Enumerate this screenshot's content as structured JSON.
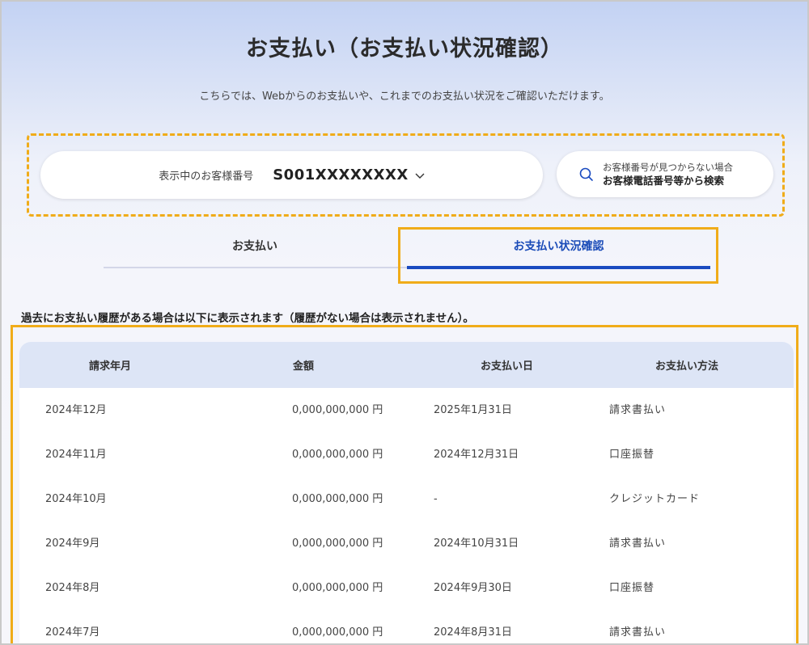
{
  "header": {
    "title": "お支払い（お支払い状況確認）",
    "description": "こちらでは、Webからのお支払いや、これまでのお支払い状況をご確認いただけます。"
  },
  "customer": {
    "label": "表示中のお客様番号",
    "number": "S001XXXXXXXX"
  },
  "search": {
    "sub_label": "お客様番号が見つからない場合",
    "main_label": "お客様電話番号等から検索"
  },
  "tabs": [
    {
      "label": "お支払い",
      "active": false
    },
    {
      "label": "お支払い状況確認",
      "active": true
    }
  ],
  "history_note": "過去にお支払い履歴がある場合は以下に表示されます（履歴がない場合は表示されません）。",
  "table": {
    "headers": [
      "請求年月",
      "金額",
      "お支払い日",
      "お支払い方法"
    ],
    "rows": [
      [
        "2024年12月",
        "0,000,000,000 円",
        "2025年1月31日",
        "請求書払い"
      ],
      [
        "2024年11月",
        "0,000,000,000 円",
        "2024年12月31日",
        "口座振替"
      ],
      [
        "2024年10月",
        "0,000,000,000 円",
        "-",
        "クレジットカード"
      ],
      [
        "2024年9月",
        "0,000,000,000 円",
        "2024年10月31日",
        "請求書払い"
      ],
      [
        "2024年8月",
        "0,000,000,000 円",
        "2024年9月30日",
        "口座振替"
      ],
      [
        "2024年7月",
        "0,000,000,000 円",
        "2024年8月31日",
        "請求書払い"
      ]
    ]
  },
  "colors": {
    "accent": "#1a4bc0",
    "highlight": "#f0ac19",
    "table_header_bg": "#dde5f6"
  }
}
